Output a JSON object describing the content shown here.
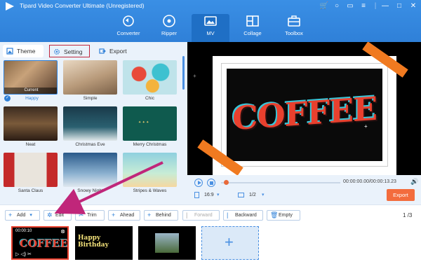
{
  "window": {
    "title": "Tipard Video Converter Ultimate (Unregistered)",
    "controls": [
      "cart-icon",
      "account-icon",
      "chat-icon",
      "menu-icon",
      "minimize-icon",
      "restore-icon",
      "close-icon"
    ]
  },
  "nav": {
    "items": [
      {
        "label": "Converter",
        "icon": "converter-icon"
      },
      {
        "label": "Ripper",
        "icon": "ripper-icon"
      },
      {
        "label": "MV",
        "icon": "mv-icon",
        "active": true
      },
      {
        "label": "Collage",
        "icon": "collage-icon"
      },
      {
        "label": "Toolbox",
        "icon": "toolbox-icon"
      }
    ]
  },
  "tabs": {
    "theme": "Theme",
    "setting": "Setting",
    "export": "Export"
  },
  "themes": [
    {
      "label": "Happy",
      "selected": true,
      "badge": "Current"
    },
    {
      "label": "Simple"
    },
    {
      "label": "Chic"
    },
    {
      "label": "Neat"
    },
    {
      "label": "Christmas Eve"
    },
    {
      "label": "Merry Christmas"
    },
    {
      "label": "Santa Claus"
    },
    {
      "label": "Snowy Night"
    },
    {
      "label": "Stripes & Waves"
    }
  ],
  "preview": {
    "text": "COFFEE",
    "time": "00:00:00.00/00:00:13.23",
    "ratio": "16:9",
    "page": "1/2",
    "export_label": "Export"
  },
  "toolbar": {
    "add": "Add",
    "edit": "Edit",
    "trim": "Trim",
    "ahead": "Ahead",
    "behind": "Behind",
    "forward": "Forward",
    "backward": "Backward",
    "empty": "Empty",
    "pager": "1 /3"
  },
  "timeline": {
    "clip1_time": "00:00:10",
    "clip1_text": "COFFEE",
    "clip2_text": "Happy Birthday"
  },
  "colors": {
    "header": "#2f80d8",
    "accent": "#f36c3d",
    "highlight": "#c0263c"
  }
}
